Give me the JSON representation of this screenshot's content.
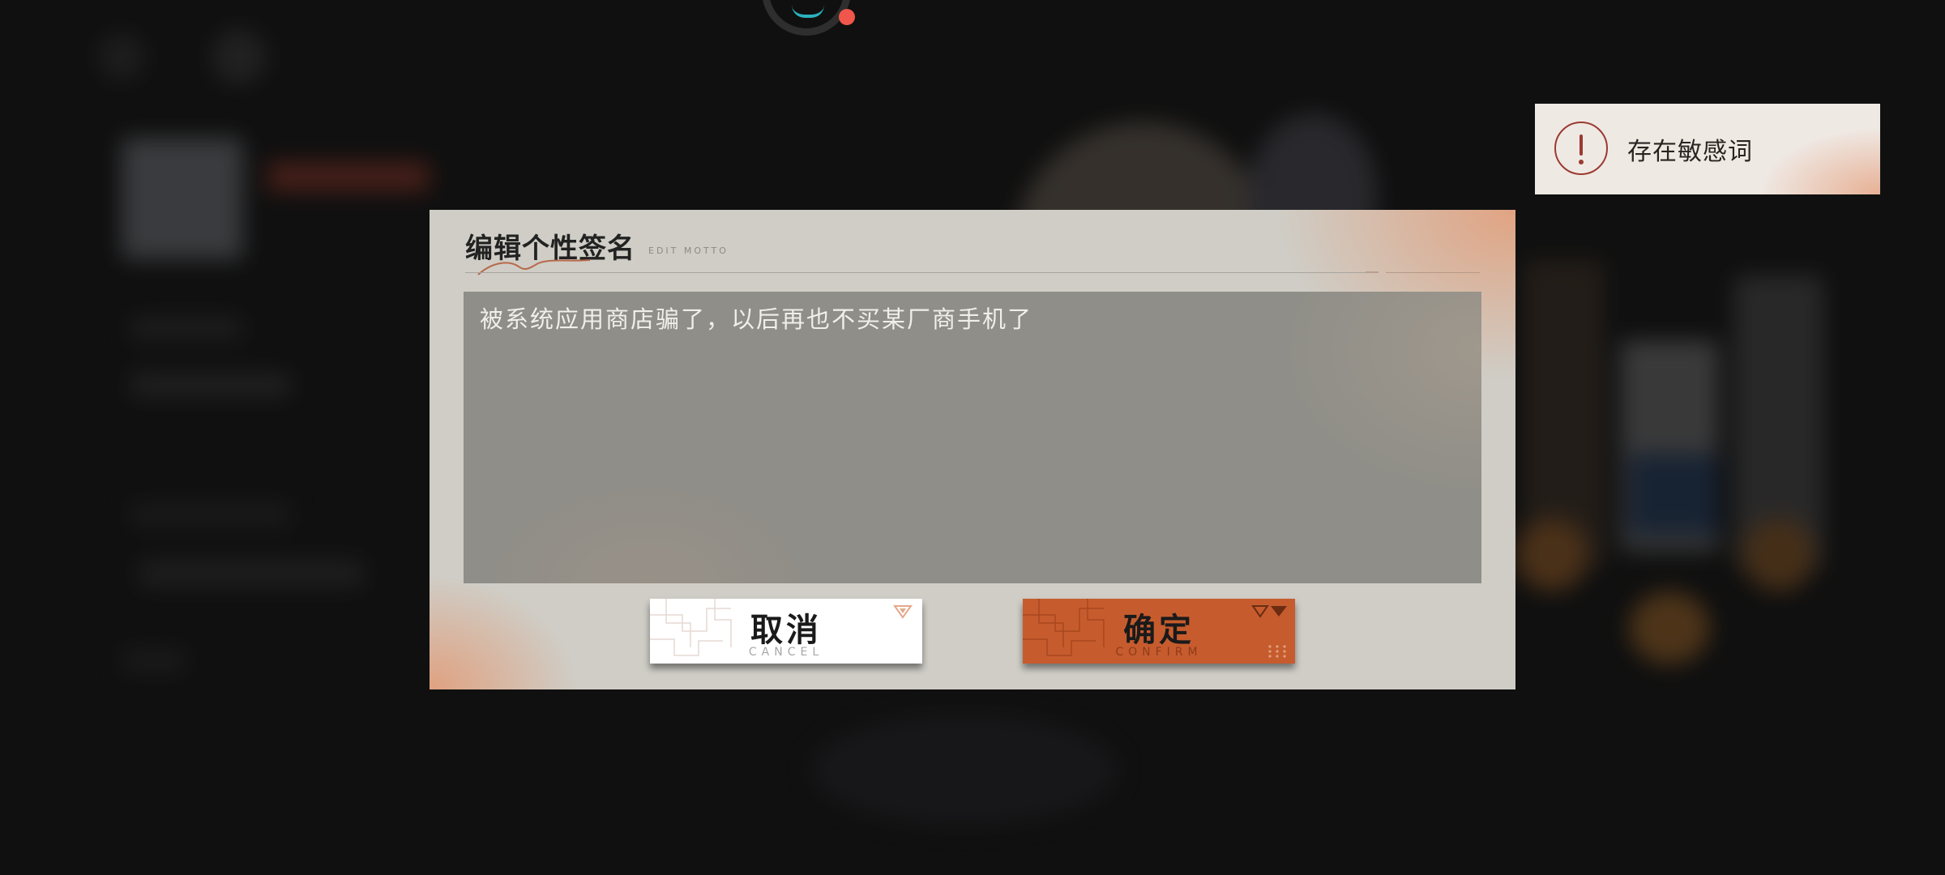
{
  "dialog": {
    "title": "编辑个性签名",
    "subtitle": "EDIT MOTTO",
    "motto_value": "被系统应用商店骗了，以后再也不买某厂商手机了"
  },
  "buttons": {
    "cancel_label": "取消",
    "cancel_sub": "CANCEL",
    "confirm_label": "确定",
    "confirm_sub": "CONFIRM"
  },
  "toast": {
    "message": "存在敏感词",
    "icon": "alert-icon"
  },
  "colors": {
    "accent": "#c65c2e",
    "dialog_bg": "#cfcdc6",
    "input_bg": "#8f8e88",
    "toast_icon": "#9a3b31",
    "indicator_teal": "#2ab3c0",
    "indicator_red": "#f0564b"
  }
}
